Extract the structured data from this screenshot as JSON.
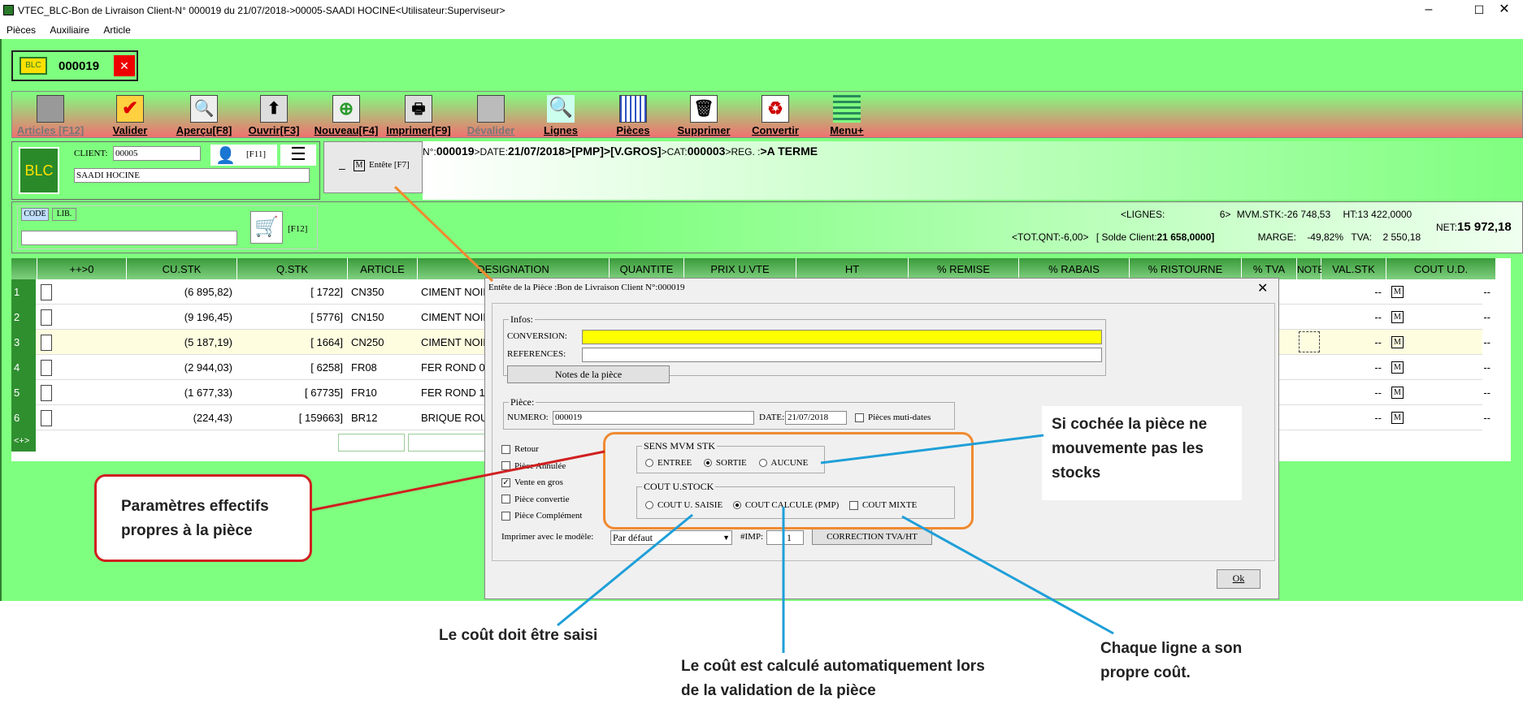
{
  "window": {
    "title": "VTEC_BLC-Bon de Livraison Client-N° 000019 du 21/07/2018->00005-SAADI HOCINE<Utilisateur:Superviseur>",
    "minimize": "–",
    "maximize": "☐",
    "close": "✕"
  },
  "menu": [
    "Pièces",
    "Auxiliaire",
    "Article"
  ],
  "doc": {
    "logo": "BLC",
    "number": "000019",
    "close": "✕"
  },
  "toolbar": [
    {
      "label": "Articles [F12]",
      "disabled": true
    },
    {
      "label": "Valider"
    },
    {
      "label": "Aperçu[F8]"
    },
    {
      "label": "Ouvrir[F3]"
    },
    {
      "label": "Nouveau[F4]"
    },
    {
      "label": "Imprimer[F9]"
    },
    {
      "label": "Dévalider",
      "disabled": true
    },
    {
      "label": "Lignes"
    },
    {
      "label": "Pièces"
    },
    {
      "label": "Supprimer"
    },
    {
      "label": "Convertir"
    },
    {
      "label": "Menu+"
    }
  ],
  "client": {
    "logo": "BLC",
    "label": "CLIENT:",
    "code": "00005",
    "name": "SAADI HOCINE",
    "f11": "[F11]"
  },
  "entete": {
    "minus": "–",
    "m": "M",
    "label": "Entête [F7]"
  },
  "header_line": {
    "n_label": "N°:",
    "number": "000019",
    "date_label": ">DATE:",
    "date": "21/07/2018",
    ">pmp": ">[PMP]",
    ">vgros": ">[V.GROS]",
    "cat_label": ">CAT:",
    "cat": "000003",
    "reg_label": ">REG. :",
    ">terme": ">A TERME"
  },
  "search": {
    "code": "CODE",
    "lib": "LIB.",
    "f12": "[F12]"
  },
  "summary": {
    "lignes_label": "<LIGNES:",
    "lignes": "6>",
    "mvm_label": "MVM.STK:",
    "mvm": "-26 748,53",
    "ht_label": "HT:",
    "ht": "13 422,0000",
    "totqnt_label": "<TOT.QNT:",
    "totqnt": "-6,00>",
    "solde_label": "[ Solde Client:",
    "solde": "21 658,0000]",
    "marge_label": "MARGE:",
    "marge": "-49,82%",
    "tva_label": "TVA:",
    "tva": "2 550,18",
    "net_label": "NET:",
    "net": "15 972,18"
  },
  "grid": {
    "headers": [
      "",
      "++>0",
      "CU.STK",
      "Q.STK",
      "ARTICLE",
      "DESIGNATION",
      "QUANTITE",
      "PRIX U.VTE",
      "HT",
      "% REMISE",
      "% RABAIS",
      "% RISTOURNE",
      "% TVA",
      "NOTE",
      "VAL.STK",
      "COUT U.D."
    ],
    "rows": [
      {
        "n": "1",
        "cu": "(6 895,82)",
        "q": "[ 1722]",
        "art": "CN350",
        "des": "CIMENT NOIRE",
        "val": "--",
        "cout": "--"
      },
      {
        "n": "2",
        "cu": "(9 196,45)",
        "q": "[ 5776]",
        "art": "CN150",
        "des": "CIMENT NOIRE,",
        "val": "--",
        "cout": "--"
      },
      {
        "n": "3",
        "cu": "(5 187,19)",
        "q": "[ 1664]",
        "art": "CN250",
        "des": "CIMENT NOIRE",
        "val": "--",
        "cout": "--"
      },
      {
        "n": "4",
        "cu": "(2 944,03)",
        "q": "[ 6258]",
        "art": "FR08",
        "des": "FER ROND 08",
        "val": "--",
        "cout": "--"
      },
      {
        "n": "5",
        "cu": "(1 677,33)",
        "q": "[ 67735]",
        "art": "FR10",
        "des": "FER ROND 10",
        "val": "--",
        "cout": "--"
      },
      {
        "n": "6",
        "cu": "(224,43)",
        "q": "[ 159663]",
        "art": "BR12",
        "des": "BRIQUE ROUGE",
        "val": "--",
        "cout": "--"
      }
    ],
    "footer": "<+>",
    "m": "M"
  },
  "dialog": {
    "title": "Entête de la Pièce :Bon de Livraison Client N°:000019",
    "close": "✕",
    "infos": "Infos:",
    "conversion": "CONVERSION:",
    "references": "REFERENCES:",
    "notes": "Notes de la pièce",
    "piece": "Pièce:",
    "numero_label": "NUMERO:",
    "numero": "000019",
    "date_label": "DATE:",
    "date": "21/07/2018",
    "multidates": "Pièces muti-dates",
    "retour": "Retour",
    "annulee": "Pièce Annulée",
    "vente_gros": "Vente en gros",
    "convertie": "Pièce convertie",
    "complement": "Pièce Complément",
    "sens_title": "SENS MVM STK",
    "entree": "ENTREE",
    "sortie": "SORTIE",
    "aucune": "AUCUNE",
    "cout_title": "COUT U.STOCK",
    "cout_saisie": "COUT U. SAISIE",
    "cout_calc": "COUT CALCULE (PMP)",
    "cout_mixte": "COUT MIXTE",
    "imprimer": "Imprimer avec le modèle:",
    "modele": "Par défaut",
    "imp_label": "#IMP:",
    "imp": "1",
    "correction": "CORRECTION TVA/HT",
    "ok": "Ok"
  },
  "callouts": {
    "params": "Paramètres effectifs propres à la  pièce",
    "cochee": "Si cochée la pièce ne mouvemente pas les stocks",
    "saisi": "Le coût doit être saisi",
    "calcule": "Le coût est calculé automatiquement lors de  la validation de la pièce",
    "ligne": "Chaque ligne a son propre coût."
  },
  "colors": {
    "green": "#7fff7f",
    "yellow": "#ffff00",
    "orange": "#f08a30",
    "red": "#d02020",
    "blue": "#1f9fd8"
  }
}
